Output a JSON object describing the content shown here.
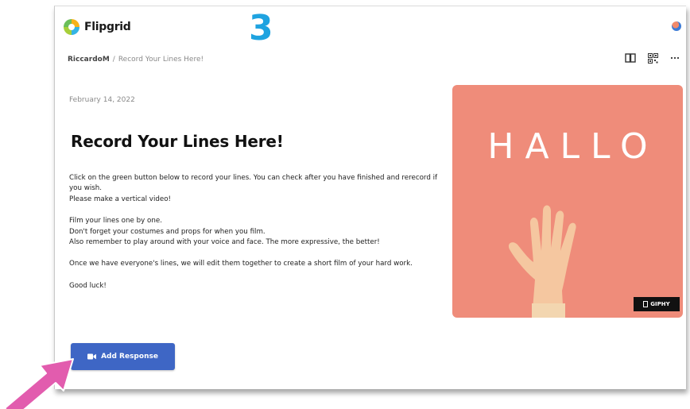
{
  "app": {
    "name": "Flipgrid"
  },
  "annotation": {
    "step_number": "3"
  },
  "breadcrumb": {
    "user": "RiccardoM",
    "separator": "/",
    "current": "Record Your Lines Here!"
  },
  "toolbar": {
    "icons": [
      "book-icon",
      "qr-code-icon",
      "more-icon"
    ]
  },
  "topic": {
    "date": "February 14, 2022",
    "title": "Record Your Lines Here!",
    "paragraphs": [
      [
        "Click on the green button below to record your lines. You can check after you have finished and rerecord if you wish.",
        "Please make a vertical video!"
      ],
      [
        "Film your lines one by one.",
        "Don't forget your costumes and props for when you film.",
        "Also remember to play around with your voice and face. The more expressive, the better!"
      ],
      [
        "Once we have everyone's lines, we will edit them together to create a short film of your hard work."
      ],
      [
        "Good luck!"
      ]
    ]
  },
  "media": {
    "gif_text": "HALLO",
    "badge": "GIPHY"
  },
  "actions": {
    "add_response_label": "Add Response"
  },
  "colors": {
    "accent": "#3e66c5",
    "step_number": "#1fa3e0",
    "gif_bg": "#ef8c7a",
    "arrow": "#e25cae"
  }
}
